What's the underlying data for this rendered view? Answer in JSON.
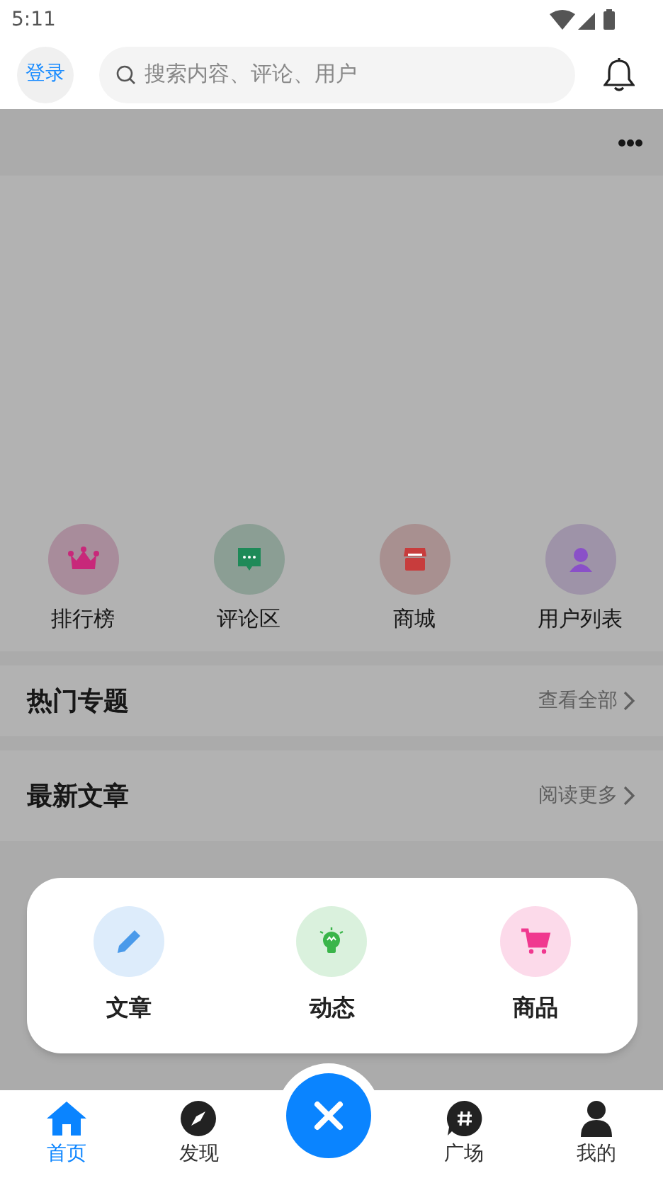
{
  "status_bar": {
    "time": "5:11"
  },
  "header": {
    "login": "登录",
    "search": {
      "placeholder": "搜索内容、评论、用户"
    }
  },
  "shortcuts": [
    {
      "kind": "crown",
      "label": "排行榜",
      "color": "#c8287a"
    },
    {
      "kind": "chat",
      "label": "评论区",
      "color": "#1e8a58"
    },
    {
      "kind": "store",
      "label": "商城",
      "color": "#c83c3c"
    },
    {
      "kind": "user",
      "label": "用户列表",
      "color": "#8a50c8"
    }
  ],
  "sections": [
    {
      "title": "热门专题",
      "link": "查看全部"
    },
    {
      "title": "最新文章",
      "link": "阅读更多"
    }
  ],
  "popup": [
    {
      "kind": "pencil",
      "label": "文章",
      "color": "#4a9aea"
    },
    {
      "kind": "bulb",
      "label": "动态",
      "color": "#3ab54a"
    },
    {
      "kind": "cart",
      "label": "商品",
      "color": "#f0388f"
    }
  ],
  "bottom_nav": [
    {
      "kind": "home",
      "label": "首页",
      "selected": true
    },
    {
      "kind": "compass",
      "label": "发现",
      "selected": false
    },
    {
      "kind": "hash",
      "label": "广场",
      "selected": false
    },
    {
      "kind": "person",
      "label": "我的",
      "selected": false
    }
  ]
}
